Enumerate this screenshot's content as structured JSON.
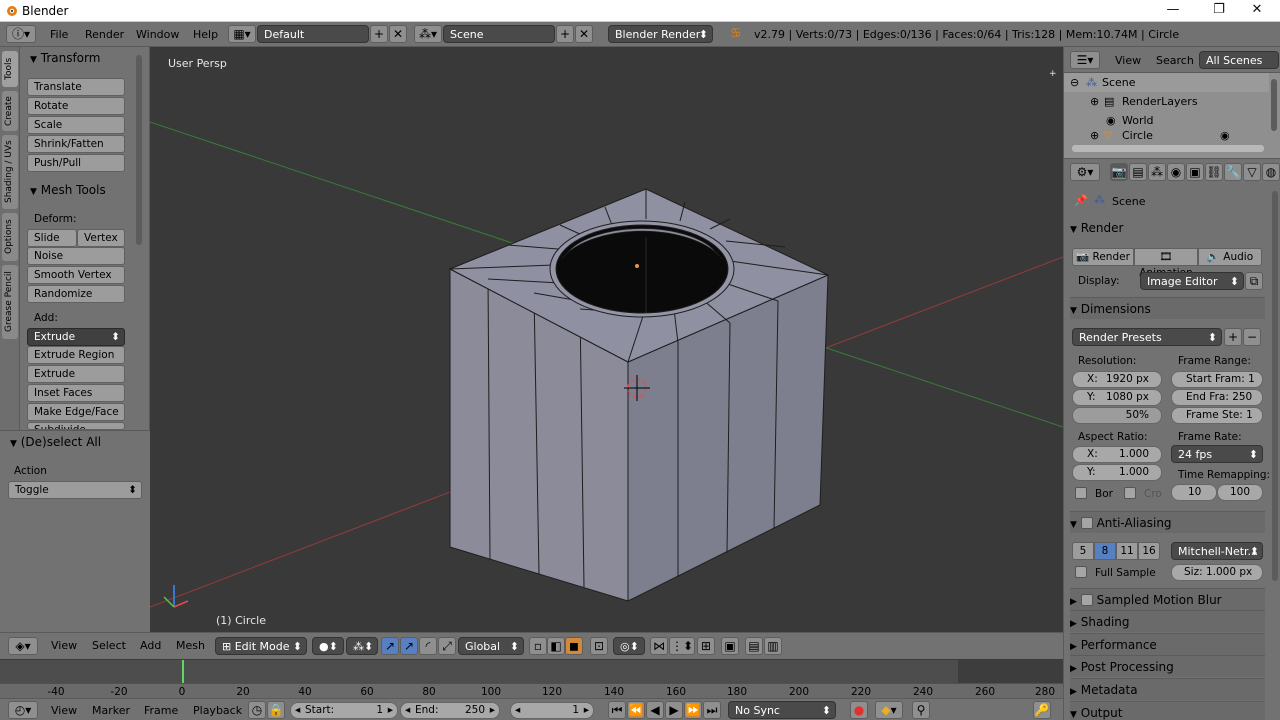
{
  "window": {
    "title": "Blender"
  },
  "window_controls": {
    "minimize": "—",
    "maximize": "❐",
    "close": "✕"
  },
  "topbar": {
    "menus": [
      "File",
      "Render",
      "Window",
      "Help"
    ],
    "layout": "Default",
    "scene": "Scene",
    "engine": "Blender Render",
    "stats": "v2.79 | Verts:0/73 | Edges:0/136 | Faces:0/64 | Tris:128 | Mem:10.74M | Circle"
  },
  "vtabs": [
    "Tools",
    "Create",
    "Shading / UVs",
    "Options",
    "Grease Pencil"
  ],
  "toolshelf": {
    "transform_title": "Transform",
    "transform_buttons": [
      "Translate",
      "Rotate",
      "Scale",
      "Shrink/Fatten",
      "Push/Pull"
    ],
    "mesh_tools_title": "Mesh Tools",
    "deform_label": "Deform:",
    "slide_edge": "Slide Ed",
    "vertex": "Vertex",
    "deform_buttons": [
      "Noise",
      "Smooth Vertex",
      "Randomize"
    ],
    "add_label": "Add:",
    "extrude": "Extrude",
    "add_buttons": [
      "Extrude Region",
      "Extrude Individual",
      "Inset Faces",
      "Make Edge/Face",
      "Subdivide"
    ]
  },
  "operator": {
    "title": "(De)select All",
    "action_label": "Action",
    "action_value": "Toggle"
  },
  "viewport": {
    "view_label": "User Persp",
    "object_label": "(1) Circle"
  },
  "vheader": {
    "menus": [
      "View",
      "Select",
      "Add",
      "Mesh"
    ],
    "mode": "Edit Mode",
    "orientation": "Global"
  },
  "timeline": {
    "ticks": [
      "-40",
      "-20",
      "0",
      "20",
      "40",
      "60",
      "80",
      "100",
      "120",
      "140",
      "160",
      "180",
      "200",
      "220",
      "240",
      "260",
      "280"
    ],
    "current_frame_marker": 0,
    "range_end": 250
  },
  "tlheader": {
    "menus": [
      "View",
      "Marker",
      "Frame",
      "Playback"
    ],
    "start_label": "Start:",
    "start_value": "1",
    "end_label": "End:",
    "end_value": "250",
    "current": "1",
    "sync": "No Sync"
  },
  "outliner": {
    "menus": [
      "View",
      "Search"
    ],
    "filter": "All Scenes",
    "rows": [
      "Scene",
      "RenderLayers",
      "World",
      "Circle"
    ]
  },
  "properties": {
    "context": "Scene",
    "render_title": "Render",
    "render_btn": "Render",
    "animation_btn": "Animation",
    "audio_btn": "Audio",
    "display_label": "Display:",
    "display_value": "Image Editor",
    "dimensions_title": "Dimensions",
    "presets": "Render Presets",
    "resolution_label": "Resolution:",
    "res_x": "X:",
    "res_x_val": "1920 px",
    "res_y": "Y:",
    "res_y_val": "1080 px",
    "res_pct": "50%",
    "frame_range_label": "Frame Range:",
    "start_frame": "Start Fram: 1",
    "end_frame": "End Fra: 250",
    "frame_step": "Frame Ste: 1",
    "aspect_label": "Aspect Ratio:",
    "asp_x": "X:",
    "asp_x_val": "1.000",
    "asp_y": "Y:",
    "asp_y_val": "1.000",
    "frame_rate_label": "Frame Rate:",
    "fps": "24 fps",
    "time_remap_label": "Time Remapping:",
    "remap_old": "10",
    "remap_new": "100",
    "border": "Bor",
    "crop": "Cro",
    "aa_title": "Anti-Aliasing",
    "aa_samples": [
      "5",
      "8",
      "11",
      "16"
    ],
    "aa_filter": "Mitchell-Netr...",
    "full_sample": "Full Sample",
    "size": "Siz: 1.000 px",
    "sections": [
      "Sampled Motion Blur",
      "Shading",
      "Performance",
      "Post Processing",
      "Metadata",
      "Output"
    ]
  },
  "colors": {
    "viewport_bg": "#393939",
    "panel_bg": "#727272",
    "mesh_face": "#8a8b9c",
    "selection_blue": "#5680c2",
    "axis_red": "#9a3a3a",
    "axis_green": "#3a7a3a"
  }
}
